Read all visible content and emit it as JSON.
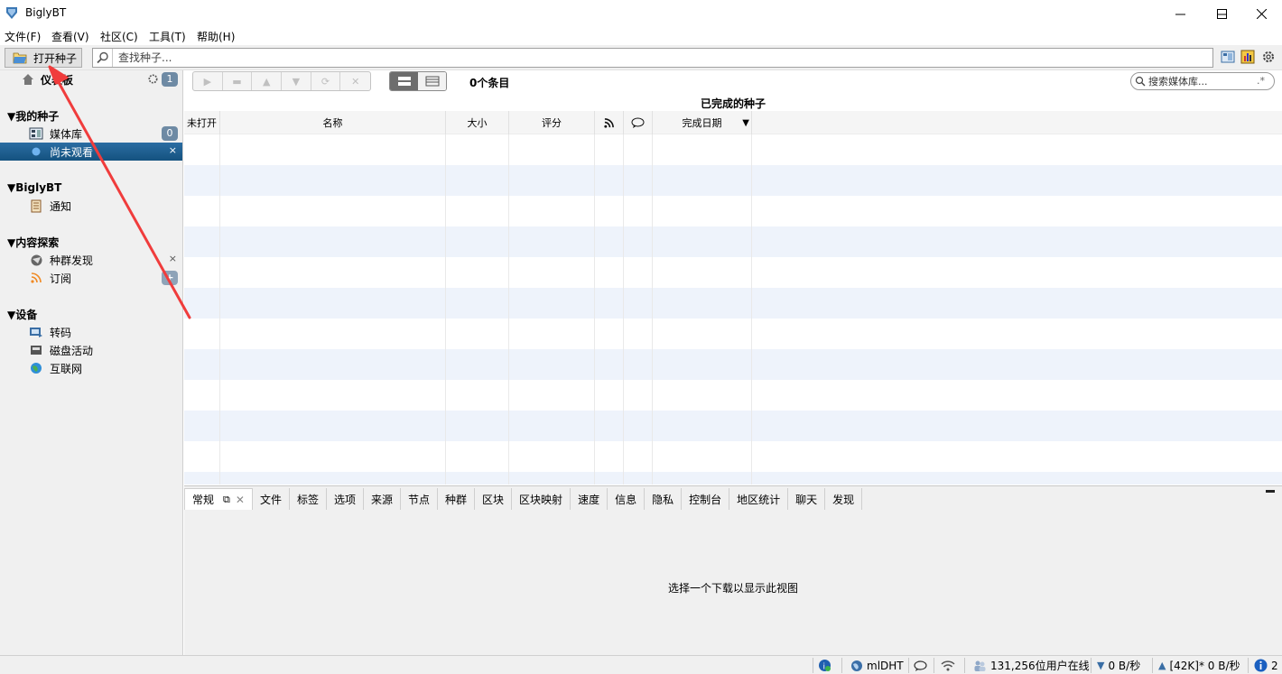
{
  "window": {
    "title": "BiglyBT"
  },
  "menu": {
    "file": "文件(F)",
    "view": "查看(V)",
    "community": "社区(C)",
    "tools": "工具(T)",
    "help": "帮助(H)"
  },
  "toolbar": {
    "open_label": "打开种子",
    "search_placeholder": "查找种子..."
  },
  "sidebar": {
    "dashboard": {
      "label": "仪表板",
      "badge": "1"
    },
    "my_torrents": {
      "label": "▼我的种子",
      "items": [
        {
          "label": "媒体库",
          "badge": "0"
        },
        {
          "label": "尚未观看",
          "close": "×"
        }
      ]
    },
    "biglybt": {
      "label": "▼BiglyBT",
      "items": [
        {
          "label": "通知"
        }
      ]
    },
    "discovery": {
      "label": "▼内容探索",
      "items": [
        {
          "label": "种群发现",
          "close": "×"
        },
        {
          "label": "订阅",
          "add": "+"
        }
      ]
    },
    "devices": {
      "label": "▼设备",
      "items": [
        {
          "label": "转码"
        },
        {
          "label": "磁盘活动"
        },
        {
          "label": "互联网"
        }
      ]
    }
  },
  "main": {
    "item_count": "0个条目",
    "media_search_placeholder": "搜索媒体库...",
    "table_title": "已完成的种子",
    "columns": [
      "未打开",
      "名称",
      "大小",
      "评分",
      "",
      "",
      "完成日期"
    ],
    "sort_indicator": "▼"
  },
  "detail": {
    "tabs": [
      "常规",
      "文件",
      "标签",
      "选项",
      "来源",
      "节点",
      "种群",
      "区块",
      "区块映射",
      "速度",
      "信息",
      "隐私",
      "控制台",
      "地区统计",
      "聊天",
      "发现"
    ],
    "message": "选择一个下载以显示此视图"
  },
  "status": {
    "dht": "mlDHT",
    "users_online": "131,256位用户在线",
    "down_speed": "0 B/秒",
    "up_speed": "[42K]* 0 B/秒",
    "info_count": "2"
  },
  "colors": {
    "selected": "#1f5f91",
    "accent_blue": "#1a73c8",
    "annotation_red": "#f03c3c"
  }
}
